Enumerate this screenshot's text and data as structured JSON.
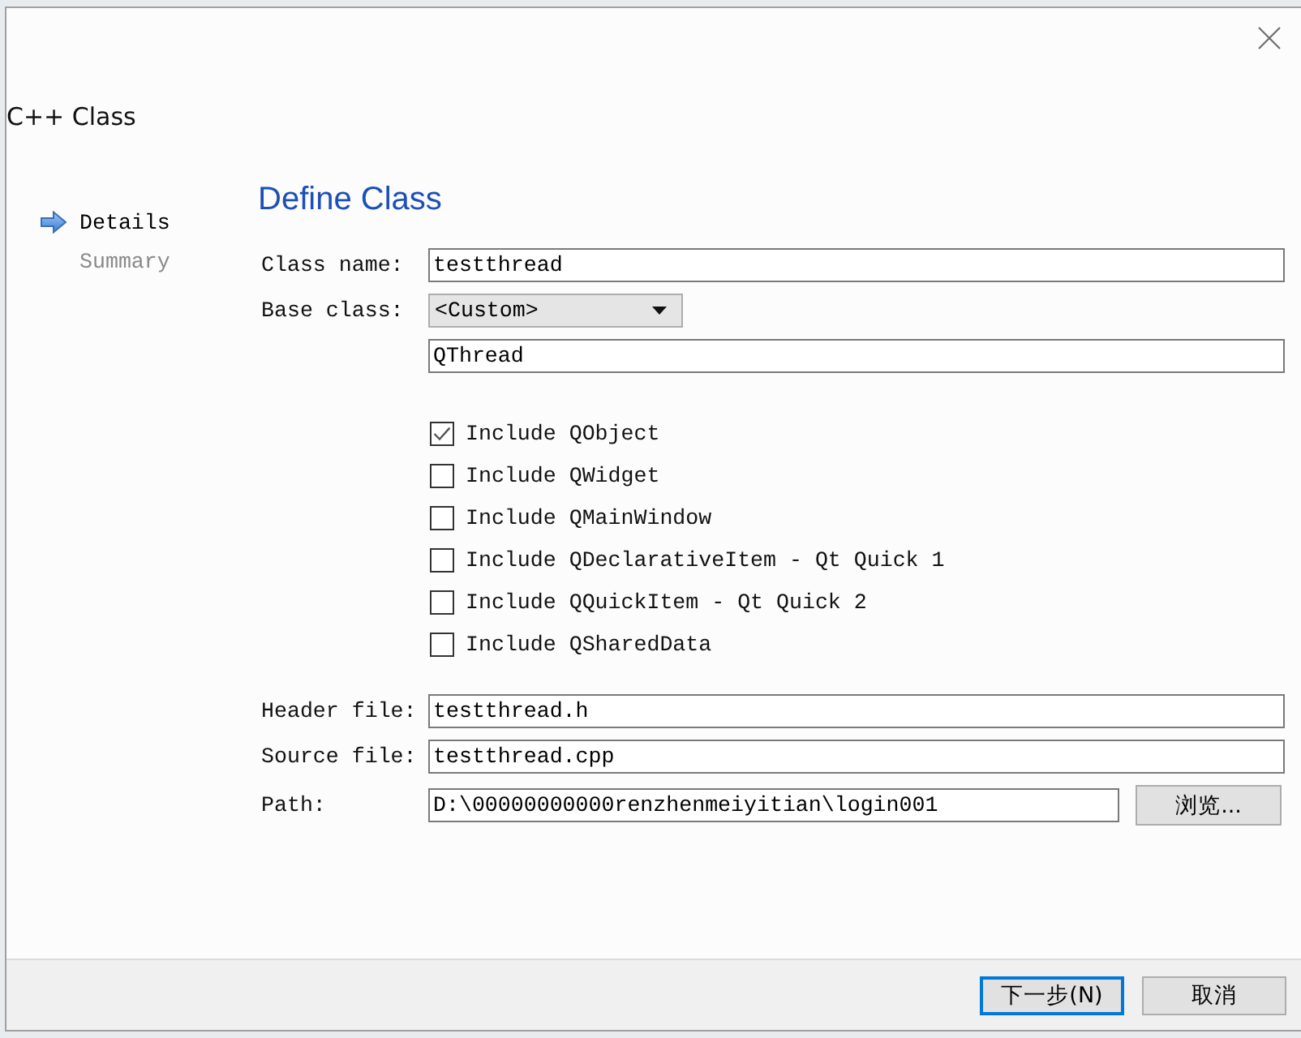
{
  "window": {
    "title": "C++ Class"
  },
  "steps": [
    {
      "label": "Details",
      "selected": true
    },
    {
      "label": "Summary",
      "selected": false
    }
  ],
  "heading": "Define Class",
  "class_fields": [
    {
      "kind": "text",
      "label": "Class name:",
      "value": "testthread"
    },
    {
      "kind": "combo",
      "label": "Base class:",
      "value": "<Custom>"
    },
    {
      "kind": "text",
      "value": "QThread"
    }
  ],
  "includes": [
    {
      "label": "Include QObject",
      "checked": true
    },
    {
      "label": "Include QWidget",
      "checked": false
    },
    {
      "label": "Include QMainWindow",
      "checked": false
    },
    {
      "label": "Include QDeclarativeItem - Qt Quick 1",
      "checked": false
    },
    {
      "label": "Include QQuickItem - Qt Quick 2",
      "checked": false
    },
    {
      "label": "Include QSharedData",
      "checked": false
    }
  ],
  "file_fields": [
    {
      "label": "Header file:",
      "value": "testthread.h"
    },
    {
      "label": "Source file:",
      "value": "testthread.cpp"
    },
    {
      "label": "Path:",
      "value": "D:\\00000000000renzhenmeiyitian\\login001",
      "button": "浏览..."
    }
  ],
  "buttons": [
    {
      "label": "下一步(N)",
      "default": true
    },
    {
      "label": "取消",
      "default": false
    }
  ]
}
